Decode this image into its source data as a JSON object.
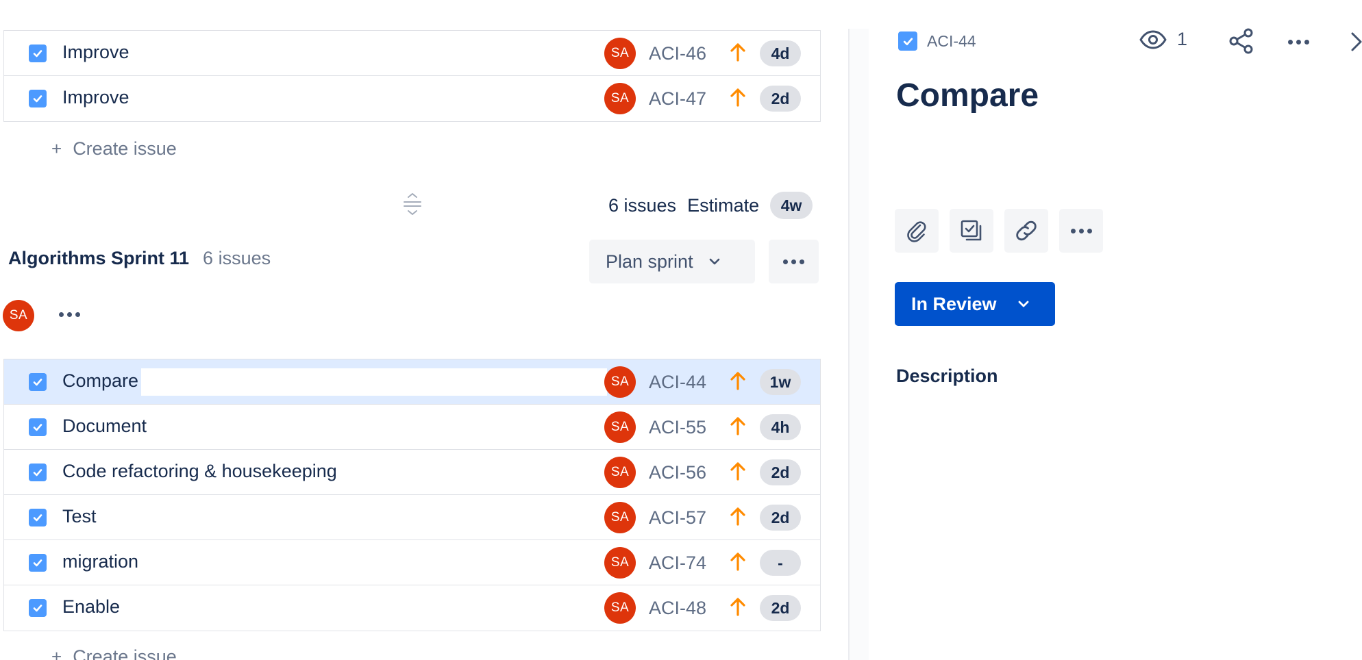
{
  "backlog_top": {
    "issues": [
      {
        "summary": "Improve",
        "avatar": "SA",
        "key": "ACI-46",
        "estimate": "4d"
      },
      {
        "summary": "Improve",
        "avatar": "SA",
        "key": "ACI-47",
        "estimate": "2d"
      }
    ],
    "create_issue_label": "Create issue"
  },
  "sprint_meta": {
    "issue_count": "6 issues",
    "estimate_label": "Estimate",
    "estimate_value": "4w"
  },
  "sprint": {
    "name": "Algorithms Sprint 11",
    "count": "6 issues",
    "plan_label": "Plan sprint",
    "avatar": "SA",
    "issues": [
      {
        "summary": "Compare",
        "avatar": "SA",
        "key": "ACI-44",
        "estimate": "1w"
      },
      {
        "summary": "Document",
        "avatar": "SA",
        "key": "ACI-55",
        "estimate": "4h"
      },
      {
        "summary": "Code refactoring & housekeeping",
        "avatar": "SA",
        "key": "ACI-56",
        "estimate": "2d"
      },
      {
        "summary": "Test",
        "avatar": "SA",
        "key": "ACI-57",
        "estimate": "2d"
      },
      {
        "summary": "migration",
        "avatar": "SA",
        "key": "ACI-74",
        "estimate": "-"
      },
      {
        "summary": "Enable",
        "avatar": "SA",
        "key": "ACI-48",
        "estimate": "2d"
      }
    ],
    "create_issue_label": "Create issue"
  },
  "detail": {
    "key": "ACI-44",
    "watchers": "1",
    "title": "Compare",
    "status": "In Review",
    "description_label": "Description"
  },
  "icons": {
    "checkbox": "story-checkbox-icon",
    "priority": "priority-high-arrow-icon",
    "watch": "eye-icon",
    "share": "share-icon",
    "more": "more-dots-icon",
    "close": "chevron-right-icon",
    "attach": "paperclip-icon",
    "child": "subtask-icon",
    "link": "link-icon",
    "drag": "drag-handle-icon"
  },
  "colors": {
    "avatar": "#de350b",
    "checkbox": "#4c9aff",
    "priority": "#ff8b00",
    "selected_row": "#deebff",
    "status_button": "#0052cc"
  }
}
